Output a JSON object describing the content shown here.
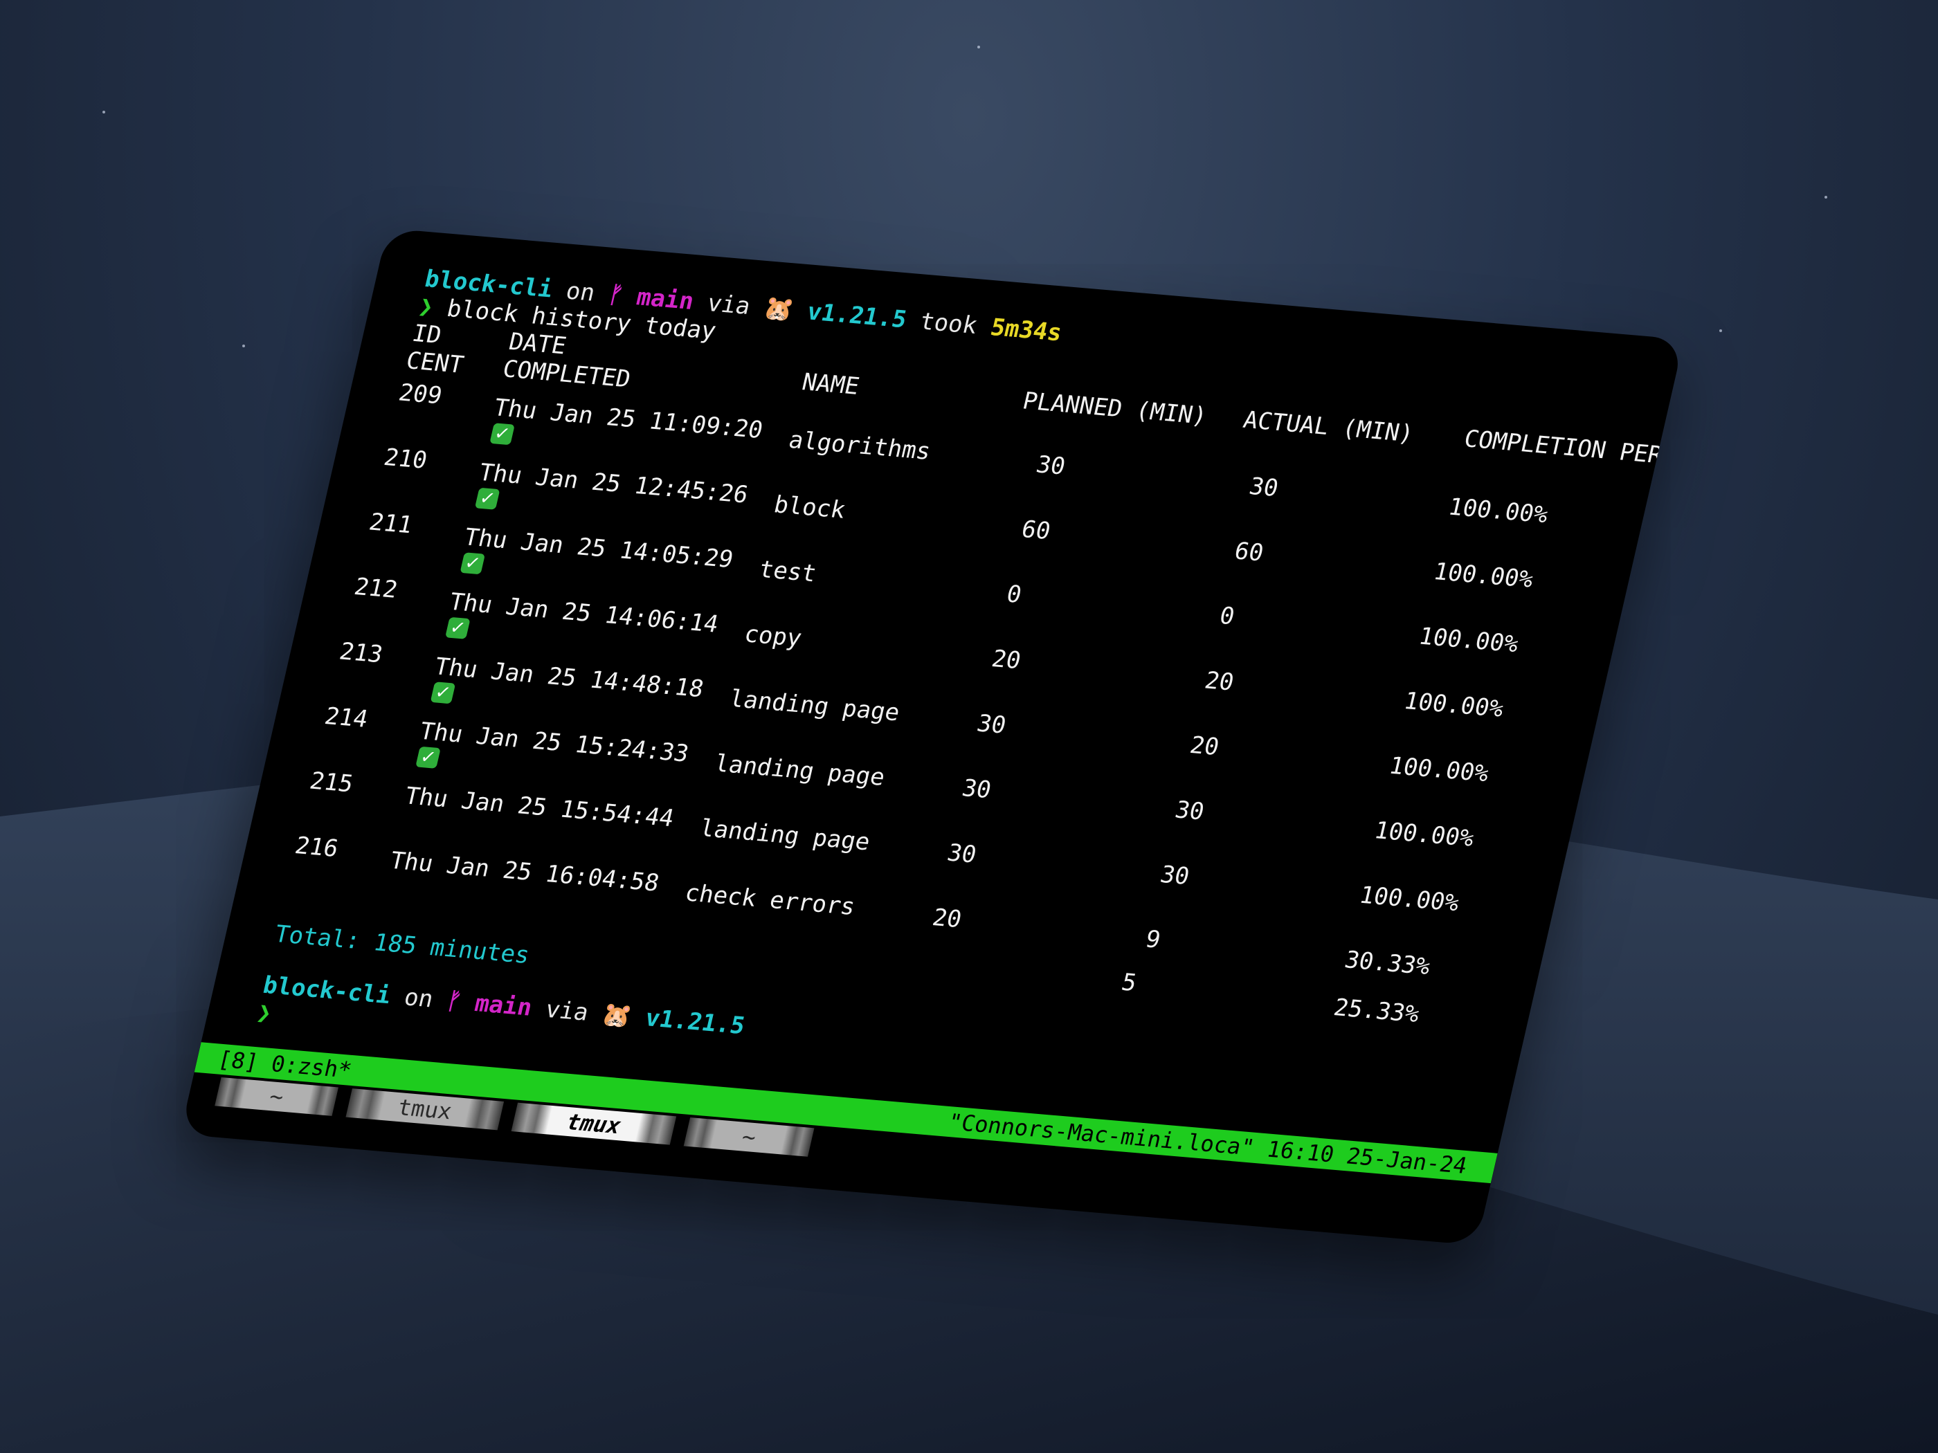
{
  "prompt1": {
    "dir": "block-cli",
    "on": "on",
    "branch_icon": "git-branch-icon",
    "branch_glyph": "ᚠ",
    "branch": "main",
    "via": "via",
    "runtime_icon": "gopher-icon",
    "runtime_glyph": "🐹",
    "version": "v1.21.5",
    "took": "took",
    "duration": "5m34s"
  },
  "command": {
    "symbol": "❯",
    "text": "block history today"
  },
  "table": {
    "headers": {
      "id_line1": "ID",
      "id_line2": "CENT",
      "date_line1": "DATE",
      "date_line2": "COMPLETED",
      "name": "NAME",
      "planned": "PLANNED (MIN)",
      "actual": "ACTUAL (MIN)",
      "completion": "COMPLETION PER"
    },
    "rows": [
      {
        "id": "209",
        "date": "Thu Jan 25 11:09:20",
        "completed": true,
        "name": "algorithms",
        "planned": "30",
        "actual": "30",
        "pct": "100.00%"
      },
      {
        "id": "210",
        "date": "Thu Jan 25 12:45:26",
        "completed": true,
        "name": "block",
        "planned": "60",
        "actual": "60",
        "pct": "100.00%"
      },
      {
        "id": "211",
        "date": "Thu Jan 25 14:05:29",
        "completed": true,
        "name": "test",
        "planned": "0",
        "actual": "0",
        "pct": "100.00%"
      },
      {
        "id": "212",
        "date": "Thu Jan 25 14:06:14",
        "completed": true,
        "name": "copy",
        "planned": "20",
        "actual": "20",
        "pct": "100.00%"
      },
      {
        "id": "213",
        "date": "Thu Jan 25 14:48:18",
        "completed": true,
        "name": "landing page",
        "planned": "30",
        "actual": "20",
        "pct": "100.00%"
      },
      {
        "id": "214",
        "date": "Thu Jan 25 15:24:33",
        "completed": true,
        "name": "landing page",
        "planned": "30",
        "actual": "30",
        "pct": "100.00%"
      },
      {
        "id": "215",
        "date": "Thu Jan 25 15:54:44",
        "completed": false,
        "name": "landing page",
        "planned": "30",
        "actual": "30",
        "pct": "100.00%"
      },
      {
        "id": "216",
        "date": "Thu Jan 25 16:04:58",
        "completed": false,
        "name": "check errors",
        "planned": "20",
        "actual": "9",
        "pct": "30.33%"
      }
    ],
    "overflow_row": {
      "actual": "5",
      "pct": "25.33%"
    }
  },
  "total": "Total: 185 minutes",
  "prompt2": {
    "dir": "block-cli",
    "on": "on",
    "branch_glyph": "ᚠ",
    "branch": "main",
    "via": "via",
    "runtime_glyph": "🐹",
    "version": "v1.21.5",
    "cursor": "❯"
  },
  "tmux": {
    "status_left": "[8] 0:zsh*",
    "status_right": "\"Connors-Mac-mini.loca\" 16:10 25-Jan-24",
    "bar_color": "#1ecc1e",
    "tabs": [
      {
        "label": "~",
        "active": false
      },
      {
        "label": "tmux",
        "active": false
      },
      {
        "label": "tmux",
        "active": true
      },
      {
        "label": "~",
        "active": false
      }
    ]
  }
}
